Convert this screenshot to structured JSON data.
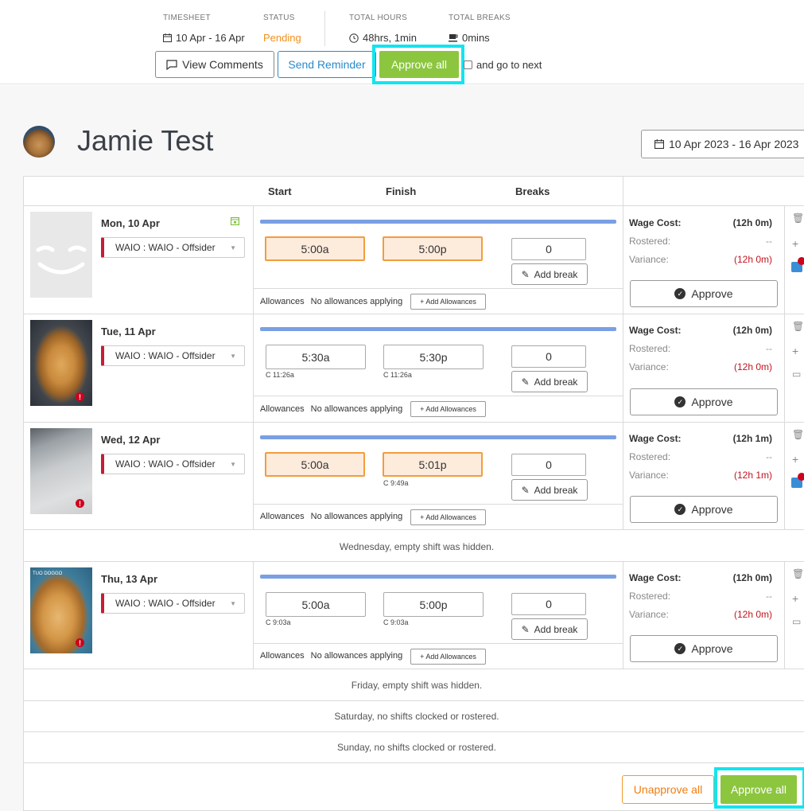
{
  "header": {
    "timesheet_label": "TIMESHEET",
    "timesheet_value": "10 Apr - 16 Apr",
    "status_label": "STATUS",
    "status_value": "Pending",
    "total_hours_label": "TOTAL HOURS",
    "total_hours_value": "48hrs, 1min",
    "total_breaks_label": "TOTAL BREAKS",
    "total_breaks_value": "0mins",
    "view_comments": "View Comments",
    "send_reminder": "Send Reminder",
    "approve_all": "Approve all",
    "go_next_label": "and go to next"
  },
  "employee": {
    "name": "Jamie Test",
    "date_range": "10 Apr 2023 - 16 Apr 2023"
  },
  "columns": {
    "start": "Start",
    "finish": "Finish",
    "breaks": "Breaks"
  },
  "shifts": [
    {
      "day": "Mon, 10 Apr",
      "role": "WAIO : WAIO - Offsider",
      "start": "5:00a",
      "finish": "5:00p",
      "start_note": "",
      "finish_note": "",
      "breaks": "0",
      "add_break": "Add break",
      "allowances_label": "Allowances",
      "allowances_value": "No allowances applying",
      "add_allowances": "+ Add Allowances",
      "wage_cost_label": "Wage Cost:",
      "wage_cost": "(12h 0m)",
      "rostered_label": "Rostered:",
      "rostered": "--",
      "variance_label": "Variance:",
      "variance": "(12h 0m)",
      "approve": "Approve"
    },
    {
      "day": "Tue, 11 Apr",
      "role": "WAIO : WAIO - Offsider",
      "start": "5:30a",
      "finish": "5:30p",
      "start_note": "C 11:26a",
      "finish_note": "C 11:26a",
      "breaks": "0",
      "add_break": "Add break",
      "allowances_label": "Allowances",
      "allowances_value": "No allowances applying",
      "add_allowances": "+ Add Allowances",
      "wage_cost_label": "Wage Cost:",
      "wage_cost": "(12h 0m)",
      "rostered_label": "Rostered:",
      "rostered": "--",
      "variance_label": "Variance:",
      "variance": "(12h 0m)",
      "approve": "Approve"
    },
    {
      "day": "Wed, 12 Apr",
      "role": "WAIO : WAIO - Offsider",
      "start": "5:00a",
      "finish": "5:01p",
      "start_note": "",
      "finish_note": "C 9:49a",
      "breaks": "0",
      "add_break": "Add break",
      "allowances_label": "Allowances",
      "allowances_value": "No allowances applying",
      "add_allowances": "+ Add Allowances",
      "wage_cost_label": "Wage Cost:",
      "wage_cost": "(12h 1m)",
      "rostered_label": "Rostered:",
      "rostered": "--",
      "variance_label": "Variance:",
      "variance": "(12h 1m)",
      "approve": "Approve"
    },
    {
      "day": "Thu, 13 Apr",
      "role": "WAIO : WAIO - Offsider",
      "start": "5:00a",
      "finish": "5:00p",
      "start_note": "C 9:03a",
      "finish_note": "C 9:03a",
      "breaks": "0",
      "add_break": "Add break",
      "allowances_label": "Allowances",
      "allowances_value": "No allowances applying",
      "add_allowances": "+ Add Allowances",
      "wage_cost_label": "Wage Cost:",
      "wage_cost": "(12h 0m)",
      "rostered_label": "Rostered:",
      "rostered": "--",
      "variance_label": "Variance:",
      "variance": "(12h 0m)",
      "approve": "Approve"
    }
  ],
  "notes": {
    "wednesday": "Wednesday, empty shift was hidden.",
    "friday": "Friday, empty shift was hidden.",
    "saturday": "Saturday, no shifts clocked or rostered.",
    "sunday": "Sunday, no shifts clocked or rostered."
  },
  "footer": {
    "unapprove_all": "Unapprove all",
    "approve_all": "Approve all"
  },
  "photo_caption": "TUO DOGGO",
  "colors": {
    "accent_green": "#8cc63f",
    "pending_orange": "#f0901c",
    "highlight_cyan": "#13e4f0",
    "variance_red": "#c0161f",
    "bar_blue": "#7a9fe3"
  },
  "icons": {
    "calendar": "calendar-icon",
    "clock": "clock-icon",
    "coffee": "coffee-icon",
    "comment": "comment-icon",
    "pencil": "pencil-icon",
    "check": "check-circle-icon",
    "trash": "trash-icon",
    "plus": "plus-icon"
  }
}
